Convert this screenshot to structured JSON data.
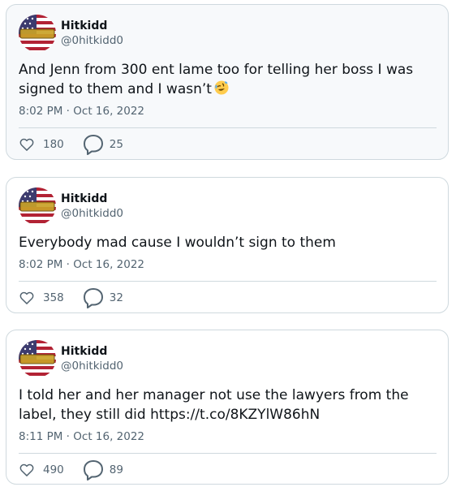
{
  "tweets": [
    {
      "user": {
        "name": "Hitkidd",
        "handle": "@0hitkidd0"
      },
      "text": "And Jenn from 300 ent lame too for telling her boss I was signed to them and I wasn’t",
      "emoji": "rolling-on-floor-laughing-emoji",
      "timestamp": "8:02 PM · Oct 16, 2022",
      "likes": "180",
      "replies": "25"
    },
    {
      "user": {
        "name": "Hitkidd",
        "handle": "@0hitkidd0"
      },
      "text": "Everybody mad cause I wouldn’t sign to them",
      "timestamp": "8:02 PM · Oct 16, 2022",
      "likes": "358",
      "replies": "32"
    },
    {
      "user": {
        "name": "Hitkidd",
        "handle": "@0hitkidd0"
      },
      "text": "I told her and her manager not use the lawyers from the label, they still did https://t.co/8KZYlW86hN",
      "timestamp": "8:11 PM · Oct 16, 2022",
      "likes": "490",
      "replies": "89"
    }
  ],
  "icons": {
    "like": "heart-icon",
    "reply": "speech-bubble-icon"
  },
  "colors": {
    "text_primary": "#0f1419",
    "text_secondary": "#536471",
    "border": "#cfd9de",
    "highlight_bg": "#f7f9fb"
  }
}
